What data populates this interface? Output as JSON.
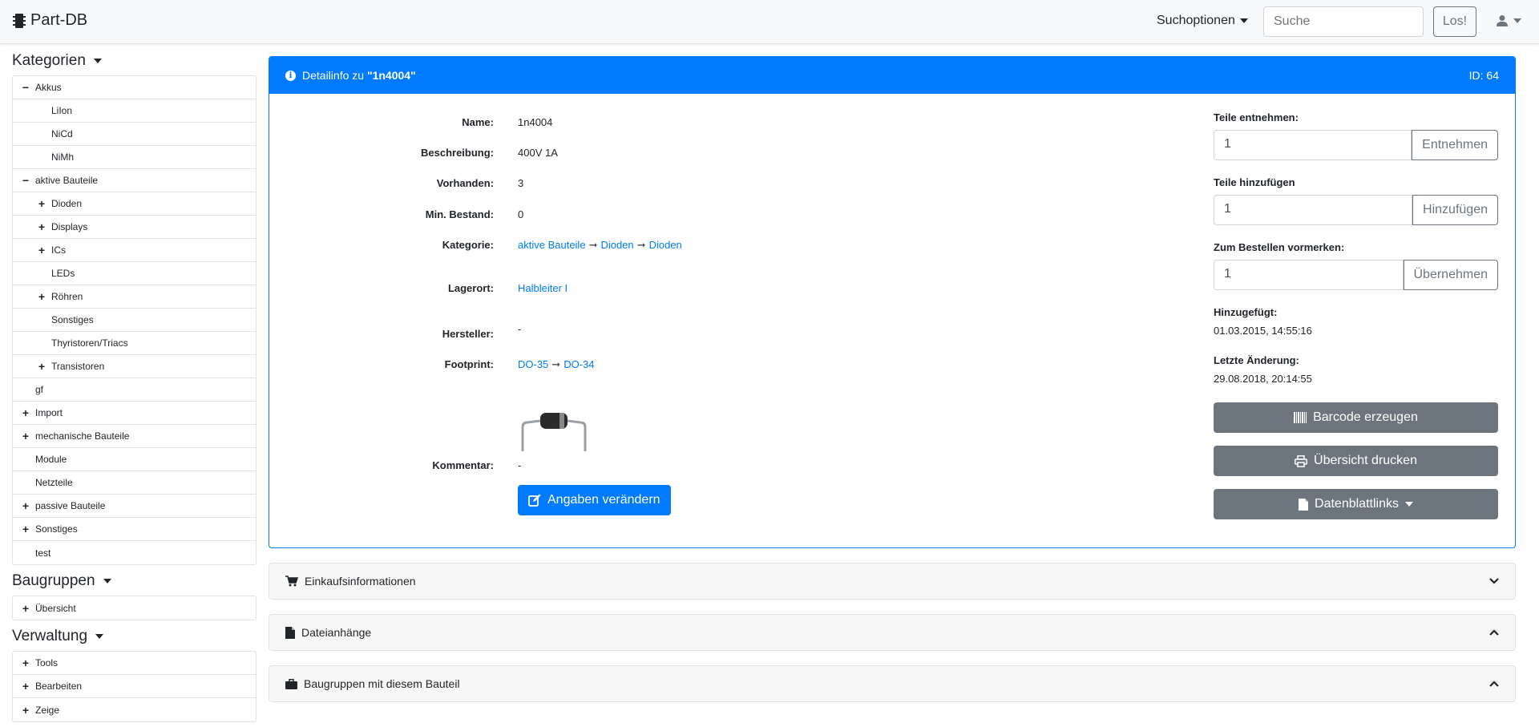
{
  "navbar": {
    "brand": "Part-DB",
    "search_options": "Suchoptionen",
    "search_placeholder": "Suche",
    "search_button": "Los!"
  },
  "sidebar": {
    "categories_heading": "Kategorien",
    "categories": [
      {
        "label": "Akkus",
        "level": 0,
        "expander": "minus"
      },
      {
        "label": "LiIon",
        "level": 1,
        "expander": ""
      },
      {
        "label": "NiCd",
        "level": 1,
        "expander": ""
      },
      {
        "label": "NiMh",
        "level": 1,
        "expander": ""
      },
      {
        "label": "aktive Bauteile",
        "level": 0,
        "expander": "minus"
      },
      {
        "label": "Dioden",
        "level": 1,
        "expander": "plus"
      },
      {
        "label": "Displays",
        "level": 1,
        "expander": "plus"
      },
      {
        "label": "ICs",
        "level": 1,
        "expander": "plus"
      },
      {
        "label": "LEDs",
        "level": 1,
        "expander": ""
      },
      {
        "label": "Röhren",
        "level": 1,
        "expander": "plus"
      },
      {
        "label": "Sonstiges",
        "level": 1,
        "expander": ""
      },
      {
        "label": "Thyristoren/Triacs",
        "level": 1,
        "expander": ""
      },
      {
        "label": "Transistoren",
        "level": 1,
        "expander": "plus"
      },
      {
        "label": "gf",
        "level": 0,
        "expander": ""
      },
      {
        "label": "Import",
        "level": 0,
        "expander": "plus"
      },
      {
        "label": "mechanische Bauteile",
        "level": 0,
        "expander": "plus"
      },
      {
        "label": "Module",
        "level": 0,
        "expander": ""
      },
      {
        "label": "Netzteile",
        "level": 0,
        "expander": ""
      },
      {
        "label": "passive Bauteile",
        "level": 0,
        "expander": "plus"
      },
      {
        "label": "Sonstiges",
        "level": 0,
        "expander": "plus"
      },
      {
        "label": "test",
        "level": 0,
        "expander": ""
      }
    ],
    "groups_heading": "Baugruppen",
    "groups": [
      {
        "label": "Übersicht",
        "level": 0,
        "expander": "plus"
      }
    ],
    "admin_heading": "Verwaltung",
    "admin": [
      {
        "label": "Tools",
        "level": 0,
        "expander": "plus"
      },
      {
        "label": "Bearbeiten",
        "level": 0,
        "expander": "plus"
      },
      {
        "label": "Zeige",
        "level": 0,
        "expander": "plus"
      }
    ]
  },
  "card": {
    "title_prefix": "Detailinfo zu ",
    "title_part": "\"1n4004\"",
    "id_label": "ID: 64",
    "fields": {
      "name_label": "Name:",
      "name_value": "1n4004",
      "desc_label": "Beschreibung:",
      "desc_value": "400V 1A",
      "stock_label": "Vorhanden:",
      "stock_value": "3",
      "minstock_label": "Min. Bestand:",
      "minstock_value": "0",
      "category_label": "Kategorie:",
      "category_path": [
        "aktive Bauteile",
        "Dioden",
        "Dioden"
      ],
      "storage_label": "Lagerort:",
      "storage_value": "Halbleiter I",
      "manufacturer_label": "Hersteller:",
      "manufacturer_value": "-",
      "footprint_label": "Footprint:",
      "footprint_path": [
        "DO-35",
        "DO-34"
      ],
      "comment_label": "Kommentar:",
      "comment_value": "-"
    },
    "edit_button": "Angaben verändern",
    "right": {
      "take_label": "Teile entnehmen:",
      "take_value": "1",
      "take_button": "Entnehmen",
      "add_label": "Teile hinzufügen",
      "add_value": "1",
      "add_button": "Hinzufügen",
      "order_label": "Zum Bestellen vormerken:",
      "order_value": "1",
      "order_button": "Übernehmen",
      "added_label": "Hinzugefügt:",
      "added_value": "01.03.2015, 14:55:16",
      "changed_label": "Letzte Änderung:",
      "changed_value": "29.08.2018, 20:14:55",
      "barcode_button": "Barcode erzeugen",
      "print_button": "Übersicht drucken",
      "datasheet_button": "Datenblattlinks"
    }
  },
  "sections": {
    "purchase": "Einkaufsinformationen",
    "attachments": "Dateianhänge",
    "assemblies": "Baugruppen mit diesem Bauteil"
  },
  "colors": {
    "primary": "#007bff",
    "secondary": "#6c757d"
  }
}
